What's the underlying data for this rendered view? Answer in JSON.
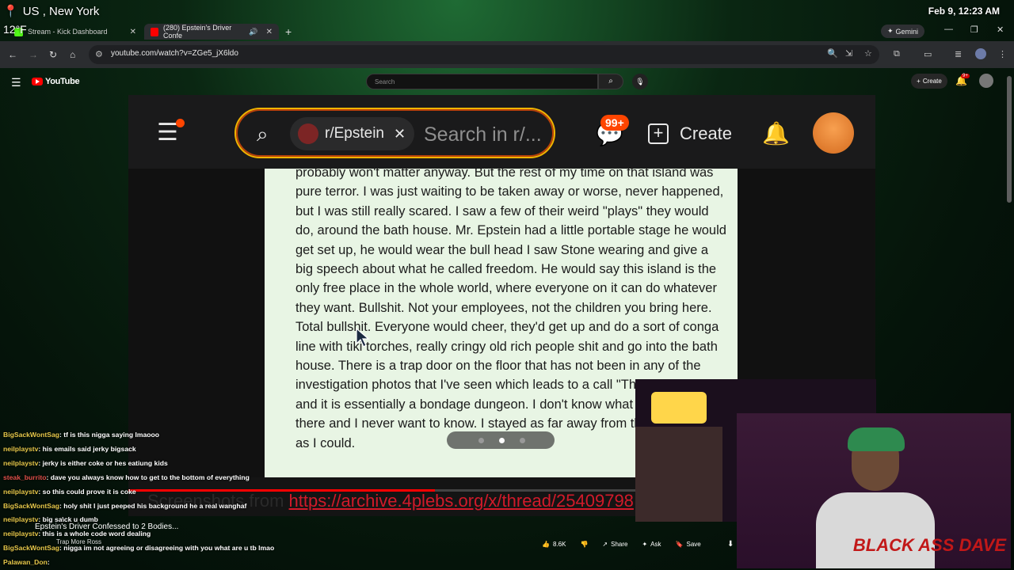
{
  "overlay": {
    "location": "US , New York",
    "temperature": "12°F",
    "datetime": "Feb 9, 12:23 AM"
  },
  "browser": {
    "tabs": [
      {
        "label": "Stream - Kick Dashboard"
      },
      {
        "label": "(280) Epstein's Driver Confe"
      }
    ],
    "gemini_label": "Gemini",
    "url": "youtube.com/watch?v=ZGe5_jX6ldo"
  },
  "youtube": {
    "logo_text": "YouTube",
    "search_placeholder": "Search",
    "create_label": "Create",
    "notif_count": "9+"
  },
  "reddit": {
    "subreddit": "r/Epstein",
    "search_placeholder": "Search in r/...",
    "chat_badge": "99+",
    "create_label": "Create",
    "post_text": "probably won't matter anyway. But the rest of my time on that island was pure terror. I was just waiting to be taken away or worse, never happened, but I was still really scared. I saw a few of their weird \"plays\" they would do, around the bath house. Mr. Epstein had a little portable stage he would get set up, he would wear the bull head I saw Stone wearing and give a big speech about what he called freedom. He would say this island is the only free place in the whole world, where everyone on it can do whatever they want. Bullshit. Not your employees, not the children you bring here. Total bullshit. Everyone would cheer, they'd get up and do a sort of conga line with tiki torches, really cringy old rich people shit and go into the bath house. There is a trap door on the floor that has not been in any of the investigation photos that I've seen which leads to a call \"The chamber\", and it is essentially a bondage dungeon. I don't know what all happened in there and I never want to know. I stayed as far away from that bath house as I could."
  },
  "caption": {
    "prefix": "Screenshots from ",
    "link": "https://archive.4plebs.org/x/thread/25409798"
  },
  "video_progress": 0.41,
  "chat": [
    {
      "user": "BigSackWontSag",
      "msg": "tf is this nigga saying lmaooo",
      "color": "#e6c84a"
    },
    {
      "user": "neilplaystv",
      "msg": "his emails said jerky bigsack",
      "color": "#e6c84a"
    },
    {
      "user": "neilplaystv",
      "msg": "jerky is either coke or hes eatiung kids",
      "color": "#e6c84a"
    },
    {
      "user": "steak_burrito",
      "msg": "dave you always know how to get to the bottom of everything",
      "color": "#e0504a"
    },
    {
      "user": "neilplaystv",
      "msg": "so this could prove it is coke",
      "color": "#e6c84a"
    },
    {
      "user": "BigSackWontSag",
      "msg": "holy shit I just peeped his background he a real wanghaf",
      "color": "#e6c84a"
    },
    {
      "user": "neilplaystv",
      "msg": "big sa\\ck u dumb",
      "color": "#e6c84a"
    },
    {
      "user": "neilplaystv",
      "msg": "this is a whole code word dealing",
      "color": "#e6c84a"
    },
    {
      "user": "BigSackWontSag",
      "msg": "nigga im not agreeing or disagreeing with you what are u tb lmao",
      "color": "#e6c84a"
    },
    {
      "user": "Palawan_Don",
      "msg": "",
      "color": "#e6c84a"
    }
  ],
  "video_title": "Epstein's Driver Confessed to 2 Bodies...",
  "chapter": "Trap More Ross",
  "actions": {
    "likes": "8.6K",
    "share": "Share",
    "ask": "Ask",
    "save": "Save"
  },
  "webcam_logo": "BLACK ASS DAVE"
}
